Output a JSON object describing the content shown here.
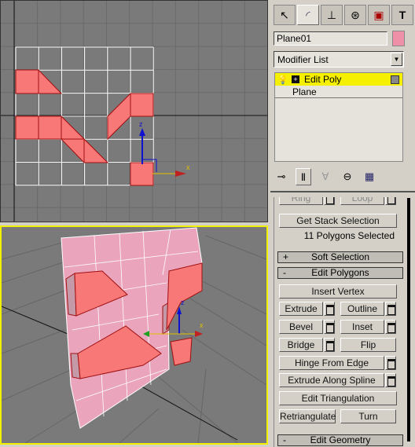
{
  "viewports": {
    "top": {
      "gizmo_z": "z",
      "gizmo_x": "x"
    },
    "perspective": {
      "gizmo_z": "z",
      "gizmo_x": "x",
      "active": true
    }
  },
  "command_panel": {
    "tabs": [
      {
        "name": "create",
        "icon": "cursor-star-icon"
      },
      {
        "name": "modify",
        "icon": "modify-arc-icon",
        "active": true
      },
      {
        "name": "hierarchy",
        "icon": "hierarchy-icon"
      },
      {
        "name": "motion",
        "icon": "motion-wheel-icon"
      },
      {
        "name": "display",
        "icon": "display-monitor-icon"
      },
      {
        "name": "utilities",
        "icon": "hammer-icon"
      }
    ],
    "object_name": "Plane01",
    "object_color": "#f090a8",
    "modifier_list_label": "Modifier List",
    "stack": [
      {
        "label": "Edit Poly",
        "selected": true
      },
      {
        "label": "Plane"
      }
    ],
    "ring_label": "Ring",
    "loop_label": "Loop",
    "get_stack_selection": "Get Stack Selection",
    "selection_status": "11 Polygons Selected",
    "soft_selection": {
      "sign": "+",
      "label": "Soft Selection"
    },
    "edit_polygons": {
      "sign": "-",
      "label": "Edit Polygons"
    },
    "buttons": {
      "insert_vertex": "Insert Vertex",
      "extrude": "Extrude",
      "outline": "Outline",
      "bevel": "Bevel",
      "inset": "Inset",
      "bridge": "Bridge",
      "flip": "Flip",
      "hinge_from_edge": "Hinge From Edge",
      "extrude_along_spline": "Extrude Along Spline",
      "edit_triangulation": "Edit Triangulation",
      "retriangulate": "Retriangulate",
      "turn": "Turn"
    },
    "edit_geometry": {
      "sign": "-",
      "label": "Edit Geometry"
    }
  }
}
